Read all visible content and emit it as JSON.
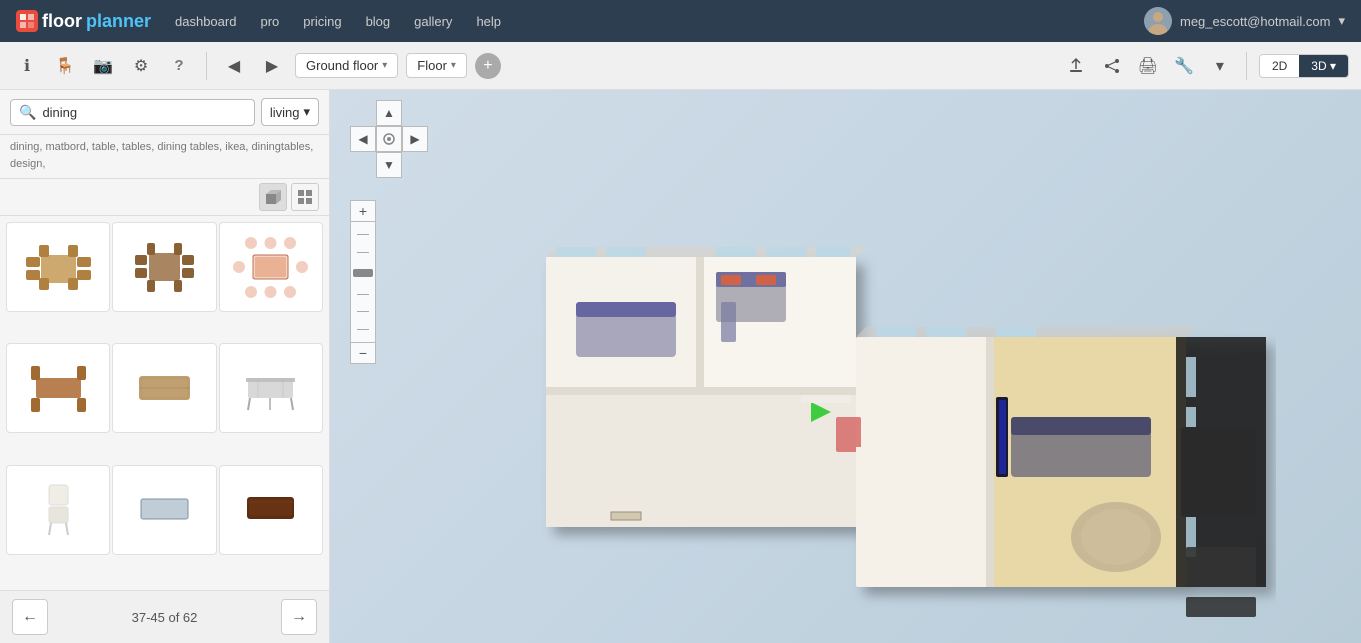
{
  "app": {
    "logo_text": "floor",
    "logo_icon": "fp",
    "logo_brand": "planner"
  },
  "nav": {
    "links": [
      "dashboard",
      "pro",
      "pricing",
      "blog",
      "gallery",
      "help"
    ],
    "user_email": "meg_escott@hotmail.com"
  },
  "toolbar": {
    "floor_label": "Ground floor",
    "view_label": "Floor",
    "btn_2d": "2D",
    "btn_3d": "3D",
    "chevron": "▾"
  },
  "sidebar": {
    "search_value": "dining",
    "search_placeholder": "dining",
    "category_label": "living",
    "tags": "dining, matbord, table, tables, dining tables, ikea, diningtables, design,",
    "view_icon_3d": "3D",
    "view_icon_grid": "▦",
    "pagination": {
      "prev_label": "←",
      "next_label": "→",
      "info": "37-45 of 62"
    },
    "furniture_items": [
      {
        "id": 1,
        "name": "dining set 1",
        "color": "#c8a882"
      },
      {
        "id": 2,
        "name": "dining set 2",
        "color": "#9e7e5e"
      },
      {
        "id": 3,
        "name": "dining set 3",
        "color": "#e8a888"
      },
      {
        "id": 4,
        "name": "chairs set",
        "color": "#b8906a"
      },
      {
        "id": 5,
        "name": "table only",
        "color": "#c0a080"
      },
      {
        "id": 6,
        "name": "modern table",
        "color": "#d0d0d0"
      },
      {
        "id": 7,
        "name": "chair single",
        "color": "#e8e0d0"
      },
      {
        "id": 8,
        "name": "glass table",
        "color": "#a0b0c0"
      },
      {
        "id": 9,
        "name": "dark table",
        "color": "#6b4030"
      }
    ]
  },
  "map": {
    "view_mode": "3D"
  },
  "icons": {
    "info": "ℹ",
    "chair": "🪑",
    "photo": "📷",
    "settings_wheel": "⚙",
    "question": "?",
    "arrow_left": "◀",
    "arrow_right": "▶",
    "share_upload": "⬆",
    "share_network": "↗",
    "print": "🖨",
    "wrench": "🔧",
    "search": "🔍"
  }
}
